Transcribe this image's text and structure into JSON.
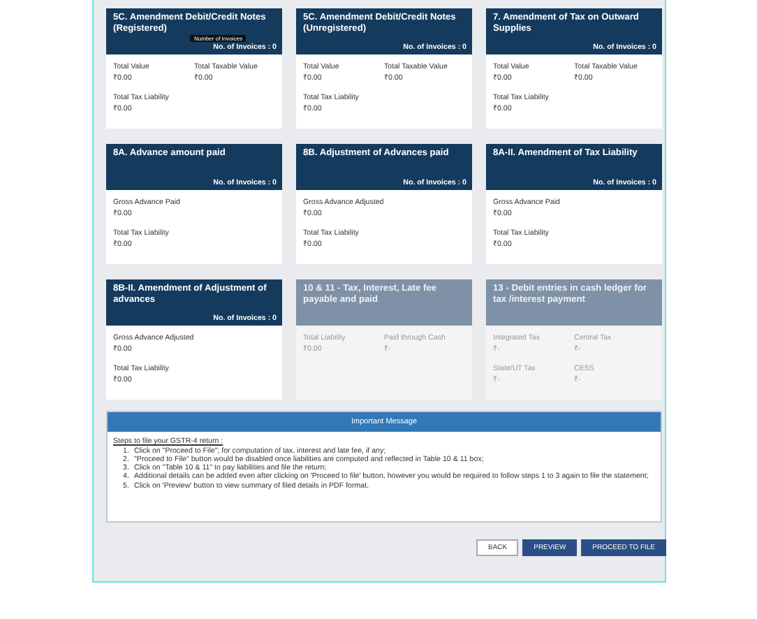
{
  "cards": [
    {
      "title": "5C. Amendment Debit/Credit Notes (Registered)",
      "invoices": "No. of Invoices : 0",
      "tooltip": "Number of Invoices",
      "disabled": false,
      "rows": [
        [
          {
            "label": "Total Value",
            "value": "₹0.00"
          },
          {
            "label": "Total Taxable Value",
            "value": "₹0.00"
          }
        ],
        [
          {
            "label": "Total Tax Liability",
            "value": "₹0.00"
          }
        ]
      ]
    },
    {
      "title": "5C. Amendment Debit/Credit Notes (Unregistered)",
      "invoices": "No. of Invoices : 0",
      "disabled": false,
      "rows": [
        [
          {
            "label": "Total Value",
            "value": "₹0.00"
          },
          {
            "label": "Total Taxable Value",
            "value": "₹0.00"
          }
        ],
        [
          {
            "label": "Total Tax Liability",
            "value": "₹0.00"
          }
        ]
      ]
    },
    {
      "title": "7. Amendment of Tax on Outward Supplies",
      "invoices": "No. of Invoices : 0",
      "disabled": false,
      "rows": [
        [
          {
            "label": "Total Value",
            "value": "₹0.00"
          },
          {
            "label": "Total Taxable Value",
            "value": "₹0.00"
          }
        ],
        [
          {
            "label": "Total Tax Liability",
            "value": "₹0.00"
          }
        ]
      ]
    },
    {
      "title": "8A. Advance amount paid",
      "invoices": "No. of Invoices : 0",
      "disabled": false,
      "rows": [
        [
          {
            "label": "Gross Advance Paid",
            "value": "₹0.00"
          }
        ],
        [
          {
            "label": "Total Tax Liability",
            "value": "₹0.00"
          }
        ]
      ]
    },
    {
      "title": "8B. Adjustment of Advances paid",
      "invoices": "No. of Invoices : 0",
      "disabled": false,
      "rows": [
        [
          {
            "label": "Gross Advance Adjusted",
            "value": "₹0.00"
          }
        ],
        [
          {
            "label": "Total Tax Liability",
            "value": "₹0.00"
          }
        ]
      ]
    },
    {
      "title": "8A-II. Amendment of Tax Liability",
      "invoices": "No. of Invoices : 0",
      "disabled": false,
      "rows": [
        [
          {
            "label": "Gross Advance Paid",
            "value": "₹0.00"
          }
        ],
        [
          {
            "label": "Total Tax Liability",
            "value": "₹0.00"
          }
        ]
      ]
    },
    {
      "title": "8B-II. Amendment of Adjustment of advances",
      "invoices": "No. of Invoices : 0",
      "disabled": false,
      "rows": [
        [
          {
            "label": "Gross Advance Adjusted",
            "value": "₹0.00"
          }
        ],
        [
          {
            "label": "Total Tax Liability",
            "value": "₹0.00"
          }
        ]
      ]
    },
    {
      "title": "10 & 11 - Tax, Interest, Late fee payable and paid",
      "disabled": true,
      "rows": [
        [
          {
            "label": "Total Liability",
            "value": "₹0.00"
          },
          {
            "label": "Paid through Cash",
            "value": "₹-"
          }
        ]
      ]
    },
    {
      "title": "13 - Debit entries in cash ledger for tax /interest payment",
      "disabled": true,
      "rows": [
        [
          {
            "label": "Integrated Tax",
            "value": "₹-"
          },
          {
            "label": "Central Tax",
            "value": "₹-"
          }
        ],
        [
          {
            "label": "State/UT Tax",
            "value": "₹-"
          },
          {
            "label": "CESS",
            "value": "₹-"
          }
        ]
      ]
    }
  ],
  "message": {
    "title": "Important Message",
    "heading": "Steps to file your GSTR-4 return :",
    "steps": [
      {
        "num": "1.",
        "text": "Click on \"Proceed to File\"; for computation of tax, interest and late fee, if any;"
      },
      {
        "num": "2.",
        "text": "\"Proceed to File\" button would be disabled once liabilities are computed and reflected in Table 10 & 11 box;"
      },
      {
        "num": "3.",
        "text": "Click on \"Table 10 & 11\" to pay liabilities and file the return;"
      },
      {
        "num": "4.",
        "text": "Additional details can be added even after clicking on 'Proceed to file' button, however you would be required to follow steps 1 to 3 again to file the statement;"
      },
      {
        "num": "5.",
        "text": "Click on 'Preview' button to view summary of filed details in PDF format."
      }
    ]
  },
  "buttons": [
    {
      "label": "BACK",
      "kind": "secondary"
    },
    {
      "label": "PREVIEW",
      "kind": "primary"
    },
    {
      "label": "PROCEED TO FILE",
      "kind": "primary"
    }
  ]
}
